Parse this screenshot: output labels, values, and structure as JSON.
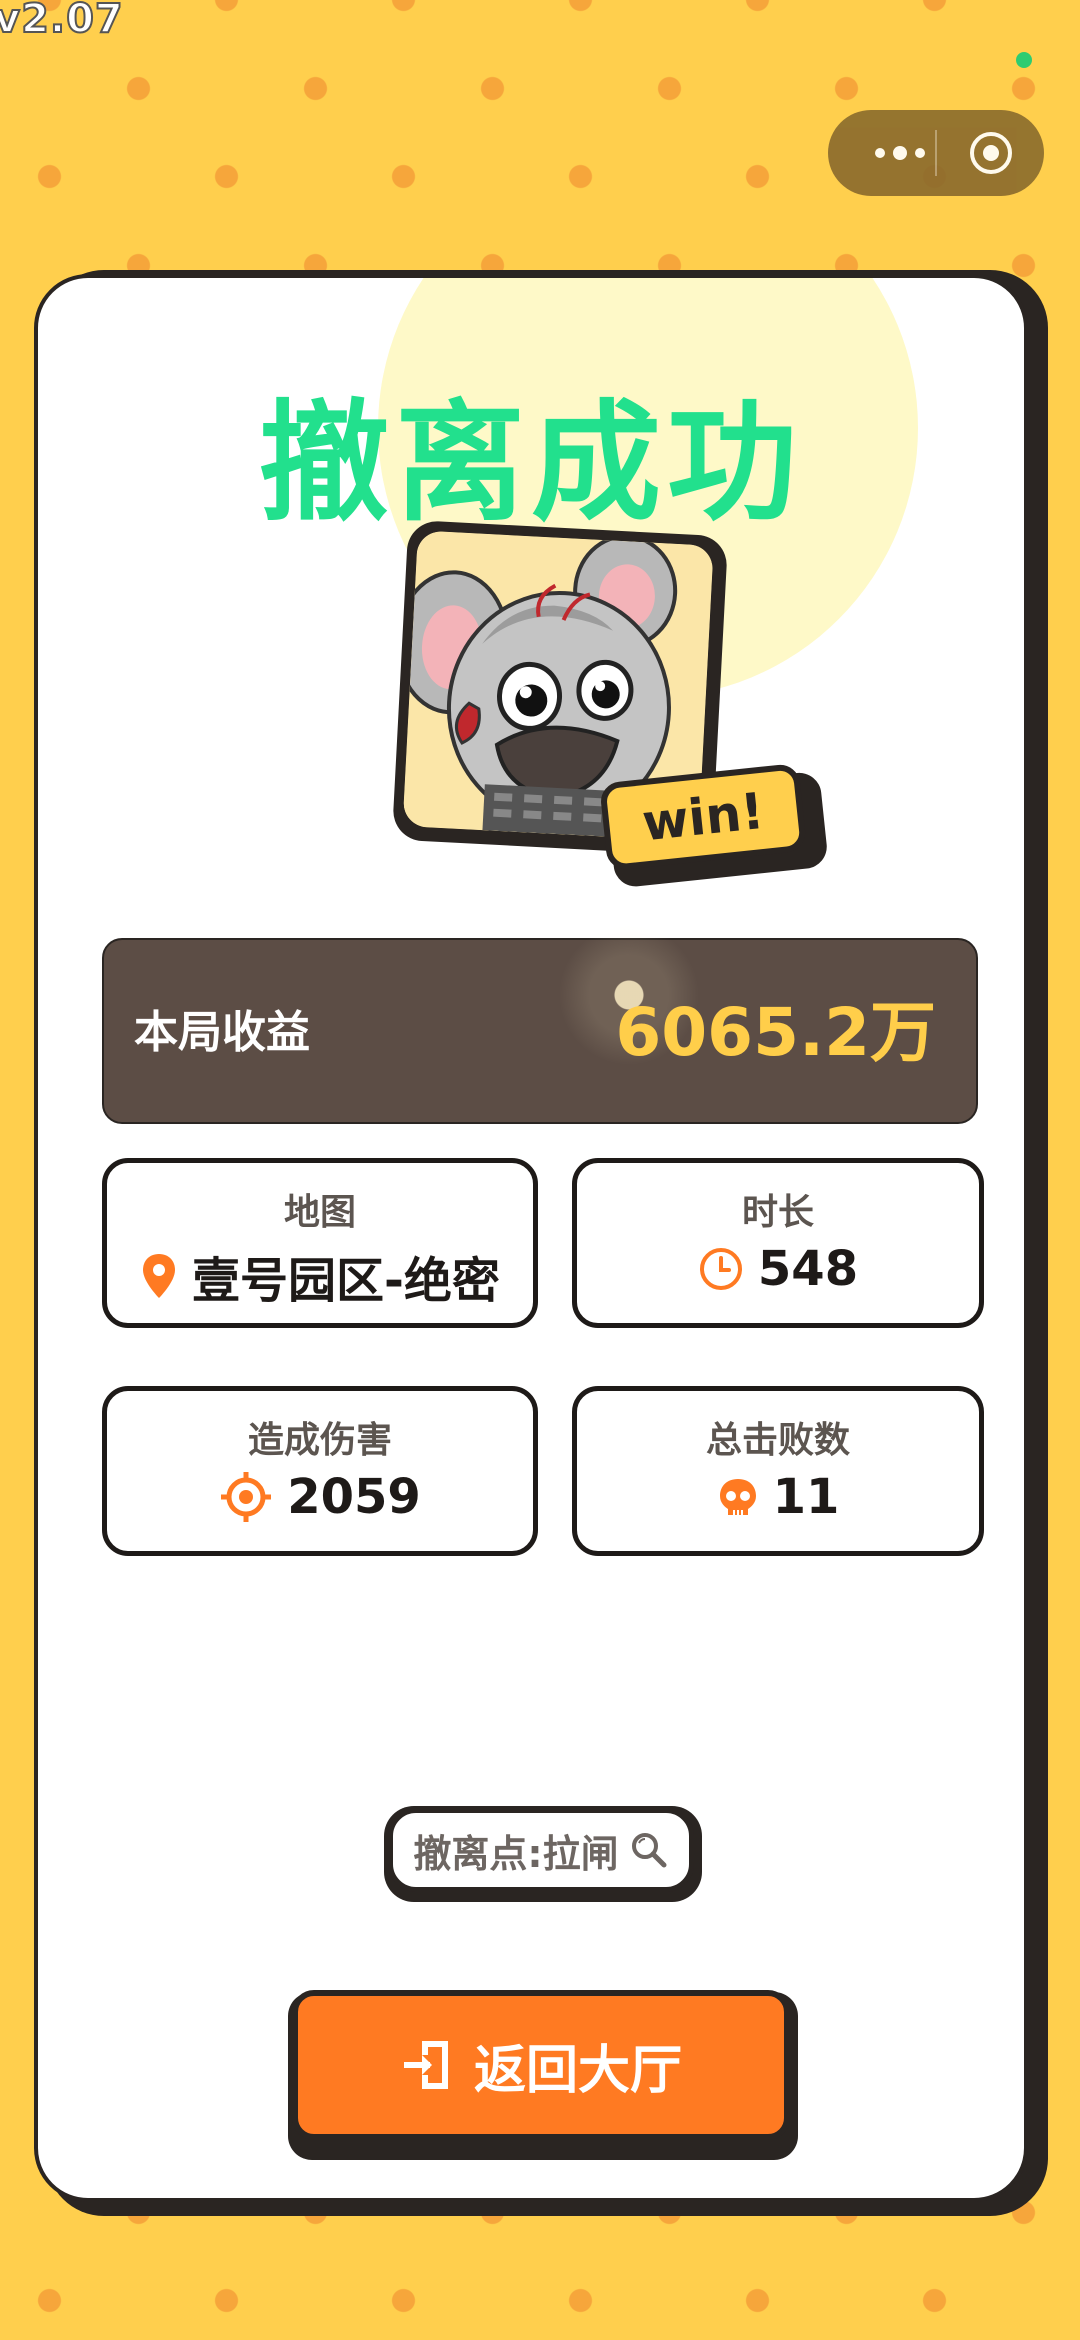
{
  "version": "v2.07",
  "title": "撤离成功",
  "badge": "win!",
  "earnings": {
    "label": "本局收益",
    "value": "6065.2万"
  },
  "stats": {
    "map": {
      "label": "地图",
      "value": "壹号园区-绝密",
      "icon": "location-pin-icon"
    },
    "duration": {
      "label": "时长",
      "value": "548",
      "icon": "clock-icon"
    },
    "damage": {
      "label": "造成伤害",
      "value": "2059",
      "icon": "crosshair-icon"
    },
    "kills": {
      "label": "总击败数",
      "value": "11",
      "icon": "skull-icon"
    }
  },
  "exit_point": {
    "label": "撤离点:拉闸",
    "icon": "search-icon"
  },
  "back_button": {
    "label": "返回大厅",
    "icon": "exit-door-icon"
  },
  "colors": {
    "accent": "#ff7a22",
    "title": "#22e08d",
    "gold": "#ffce4a",
    "panel": "#5c4d45",
    "background": "#ffcf4d"
  }
}
